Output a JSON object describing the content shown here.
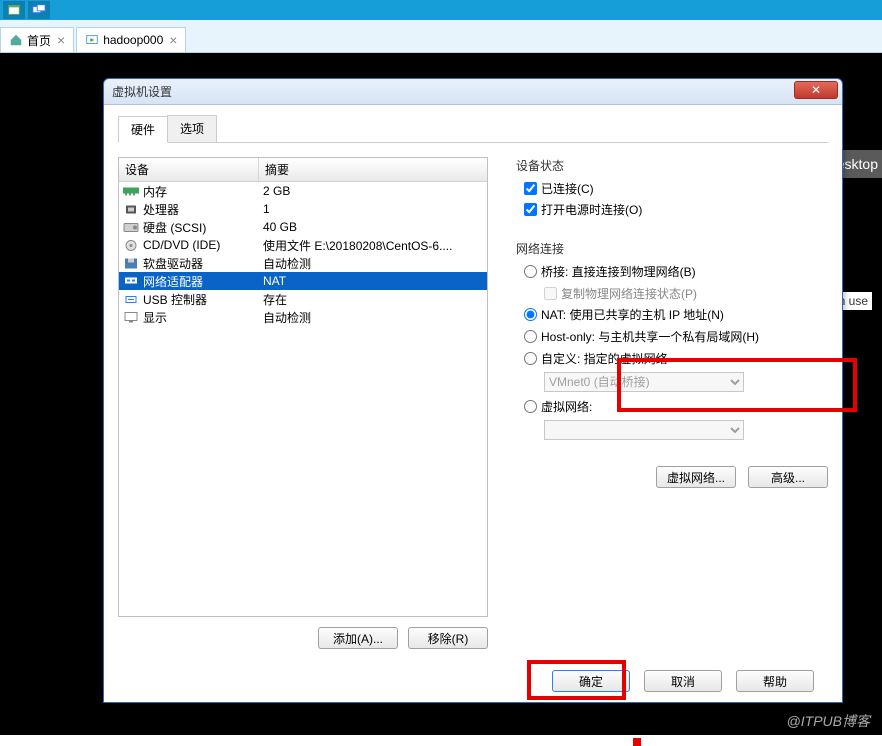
{
  "toolbar": {},
  "maintabs": {
    "home": "首页",
    "vm": "hadoop000"
  },
  "desktop_tag": "Desktop",
  "inuse": "in use",
  "watermark": "@ITPUB博客",
  "dialog": {
    "title": "虚拟机设置",
    "tab_hw": "硬件",
    "tab_opt": "选项",
    "col_device": "设备",
    "col_summary": "摘要",
    "rows": [
      {
        "name": "内存",
        "summary": "2 GB"
      },
      {
        "name": "处理器",
        "summary": "1"
      },
      {
        "name": "硬盘 (SCSI)",
        "summary": "40 GB"
      },
      {
        "name": "CD/DVD (IDE)",
        "summary": "使用文件 E:\\20180208\\CentOS-6...."
      },
      {
        "name": "软盘驱动器",
        "summary": "自动检测"
      },
      {
        "name": "网络适配器",
        "summary": "NAT"
      },
      {
        "name": "USB 控制器",
        "summary": "存在"
      },
      {
        "name": "显示",
        "summary": "自动检测"
      }
    ],
    "btn_add": "添加(A)...",
    "btn_remove": "移除(R)",
    "dev_state": "设备状态",
    "chk_connected": "已连接(C)",
    "chk_poweron": "打开电源时连接(O)",
    "net_conn": "网络连接",
    "r_bridge": "桥接: 直接连接到物理网络(B)",
    "chk_copy": "复制物理网络连接状态(P)",
    "r_nat": "NAT: 使用已共享的主机 IP 地址(N)",
    "r_host": "Host-only: 与主机共享一个私有局域网(H)",
    "r_custom": "自定义: 指定的虚拟网络",
    "sel_vmnet": "VMnet0 (自动桥接)",
    "r_virt": "虚拟网络:",
    "btn_virtnet": "虚拟网络...",
    "btn_adv": "高级...",
    "btn_ok": "确定",
    "btn_cancel": "取消",
    "btn_help": "帮助"
  }
}
